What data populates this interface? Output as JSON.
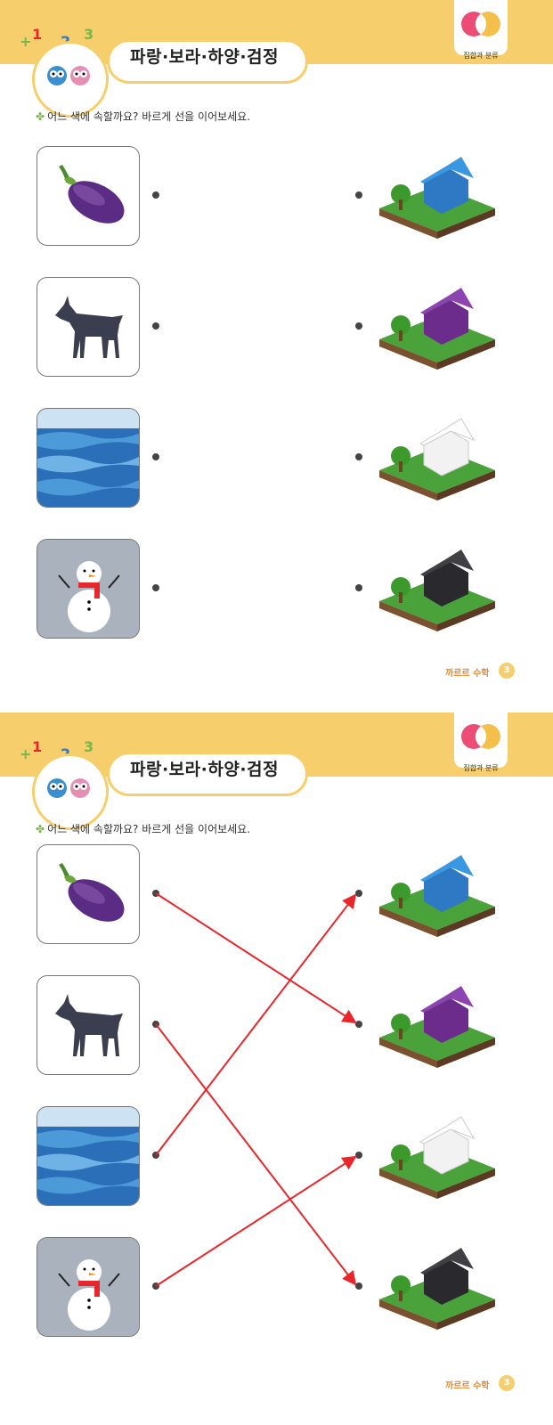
{
  "pages": [
    {
      "title": "파랑·보라·하양·검정",
      "corner_label": "집합과 분류",
      "instruction": "어느 색에 속할까요? 바르게 선을 이어보세요.",
      "footer_brand": "까르르 수학",
      "page_number": "3"
    },
    {
      "title": "파랑·보라·하양·검정",
      "corner_label": "집합과 분류",
      "instruction": "어느 색에 속할까요? 바르게 선을 이어보세요.",
      "footer_brand": "까르르 수학",
      "page_number": "3"
    }
  ],
  "left_items": [
    "eggplant",
    "black-goat",
    "blue-sea",
    "snowman"
  ],
  "right_items": [
    "blue-house",
    "purple-house",
    "white-house",
    "black-house"
  ],
  "answer_matches": [
    {
      "from": "eggplant",
      "to": "purple-house"
    },
    {
      "from": "black-goat",
      "to": "black-house"
    },
    {
      "from": "blue-sea",
      "to": "blue-house"
    },
    {
      "from": "snowman",
      "to": "white-house"
    }
  ],
  "colors": {
    "header_band": "#f6cf6c",
    "answer_line": "#e8262b",
    "accent": "#e28c33"
  }
}
